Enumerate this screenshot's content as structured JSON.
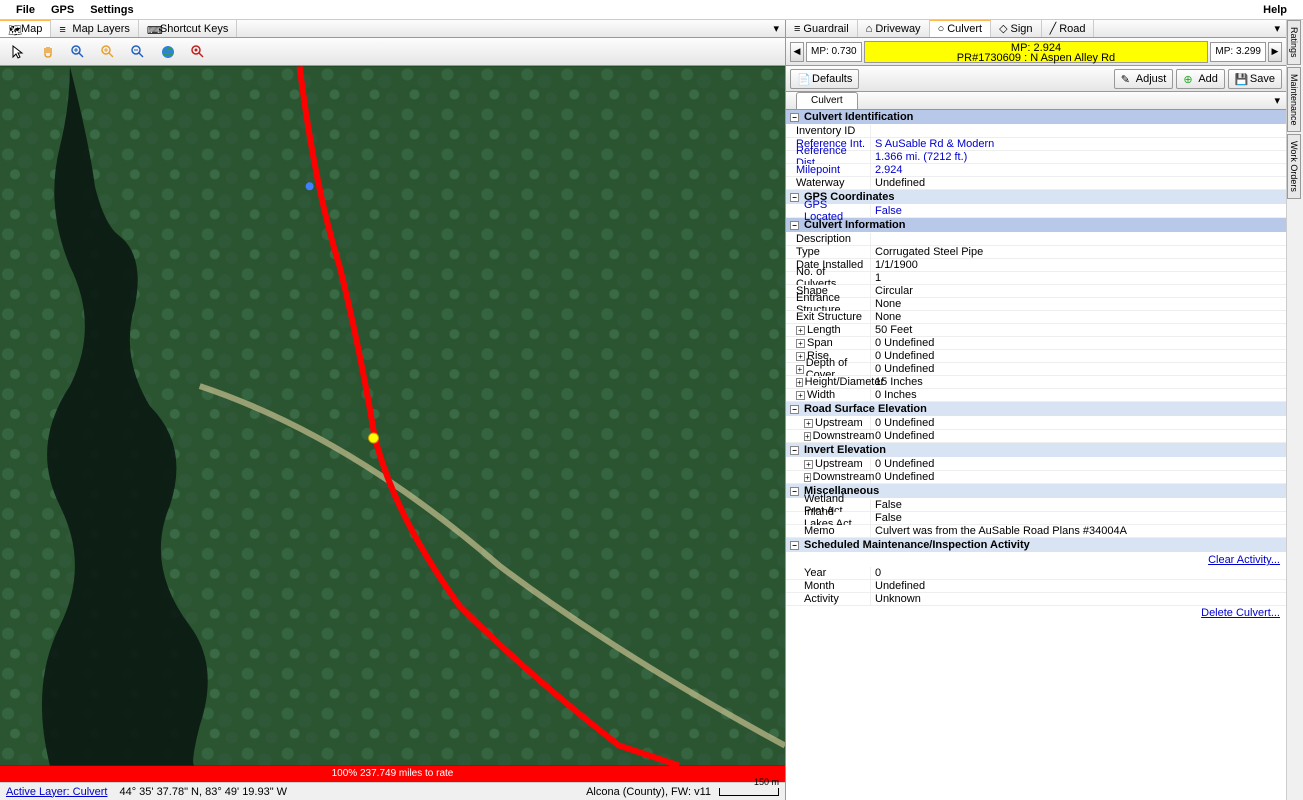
{
  "menu": {
    "file": "File",
    "gps": "GPS",
    "settings": "Settings",
    "help": "Help"
  },
  "left_tabs": {
    "map": "Map",
    "layers": "Map Layers",
    "shortcuts": "Shortcut Keys"
  },
  "right_tabs": {
    "guardrail": "Guardrail",
    "driveway": "Driveway",
    "culvert": "Culvert",
    "sign": "Sign",
    "road": "Road"
  },
  "mp": {
    "left": "MP: 0.730",
    "center_mp": "MP: 2.924",
    "center_pr": "PR#1730609 : N Aspen Alley Rd",
    "right": "MP: 3.299"
  },
  "actions": {
    "defaults": "Defaults",
    "adjust": "Adjust",
    "add": "Add",
    "save": "Save"
  },
  "subtab": "Culvert",
  "sections": {
    "ident": "Culvert Identification",
    "gps_coords": "GPS Coordinates",
    "info": "Culvert Information",
    "rse": "Road Surface Elevation",
    "inv": "Invert Elevation",
    "misc": "Miscellaneous",
    "sched": "Scheduled Maintenance/Inspection Activity"
  },
  "fields": {
    "inventory_id": {
      "label": "Inventory ID",
      "value": ""
    },
    "ref_int": {
      "label": "Reference Int.",
      "value": "S AuSable Rd & Modern"
    },
    "ref_dist": {
      "label": "Reference Dist.",
      "value": "1.366 mi. (7212 ft.)"
    },
    "milepoint": {
      "label": "Milepoint",
      "value": "2.924"
    },
    "waterway": {
      "label": "Waterway",
      "value": "Undefined"
    },
    "gps_located": {
      "label": "GPS Located",
      "value": "False"
    },
    "description": {
      "label": "Description",
      "value": ""
    },
    "type": {
      "label": "Type",
      "value": "Corrugated Steel Pipe"
    },
    "date_installed": {
      "label": "Date Installed",
      "value": "1/1/1900"
    },
    "no_culverts": {
      "label": "No. of Culverts",
      "value": "1"
    },
    "shape": {
      "label": "Shape",
      "value": "Circular"
    },
    "entrance": {
      "label": "Entrance Structure",
      "value": "None"
    },
    "exit": {
      "label": "Exit Structure",
      "value": "None"
    },
    "length": {
      "label": "Length",
      "value": "50 Feet"
    },
    "span": {
      "label": "Span",
      "value": "0 Undefined"
    },
    "rise": {
      "label": "Rise",
      "value": "0 Undefined"
    },
    "depth": {
      "label": "Depth of Cover",
      "value": "0 Undefined"
    },
    "height": {
      "label": "Height/Diameter",
      "value": "15 Inches"
    },
    "width": {
      "label": "Width",
      "value": "0 Inches"
    },
    "rse_up": {
      "label": "Upstream",
      "value": "0 Undefined"
    },
    "rse_down": {
      "label": "Downstream",
      "value": "0 Undefined"
    },
    "inv_up": {
      "label": "Upstream",
      "value": "0 Undefined"
    },
    "inv_down": {
      "label": "Downstream",
      "value": "0 Undefined"
    },
    "wetland": {
      "label": "Wetland Prot Act",
      "value": "False"
    },
    "inland": {
      "label": "Inland Lakes Act",
      "value": "False"
    },
    "memo": {
      "label": "Memo",
      "value": "Culvert was from the AuSable Road Plans #34004A"
    },
    "year": {
      "label": "Year",
      "value": "0"
    },
    "month": {
      "label": "Month",
      "value": "Undefined"
    },
    "activity": {
      "label": "Activity",
      "value": "Unknown"
    }
  },
  "links": {
    "clear": "Clear Activity...",
    "delete": "Delete Culvert..."
  },
  "red_bar": "100% 237.749 miles to rate",
  "status": {
    "active_layer": "Active Layer: Culvert",
    "coords": "44° 35' 37.78\" N, 83° 49' 19.93\" W",
    "county": "Alcona (County), FW: v11",
    "scale": "150 m"
  },
  "side_tabs": {
    "ratings": "Ratings",
    "maint": "Maintenance",
    "work": "Work Orders"
  }
}
